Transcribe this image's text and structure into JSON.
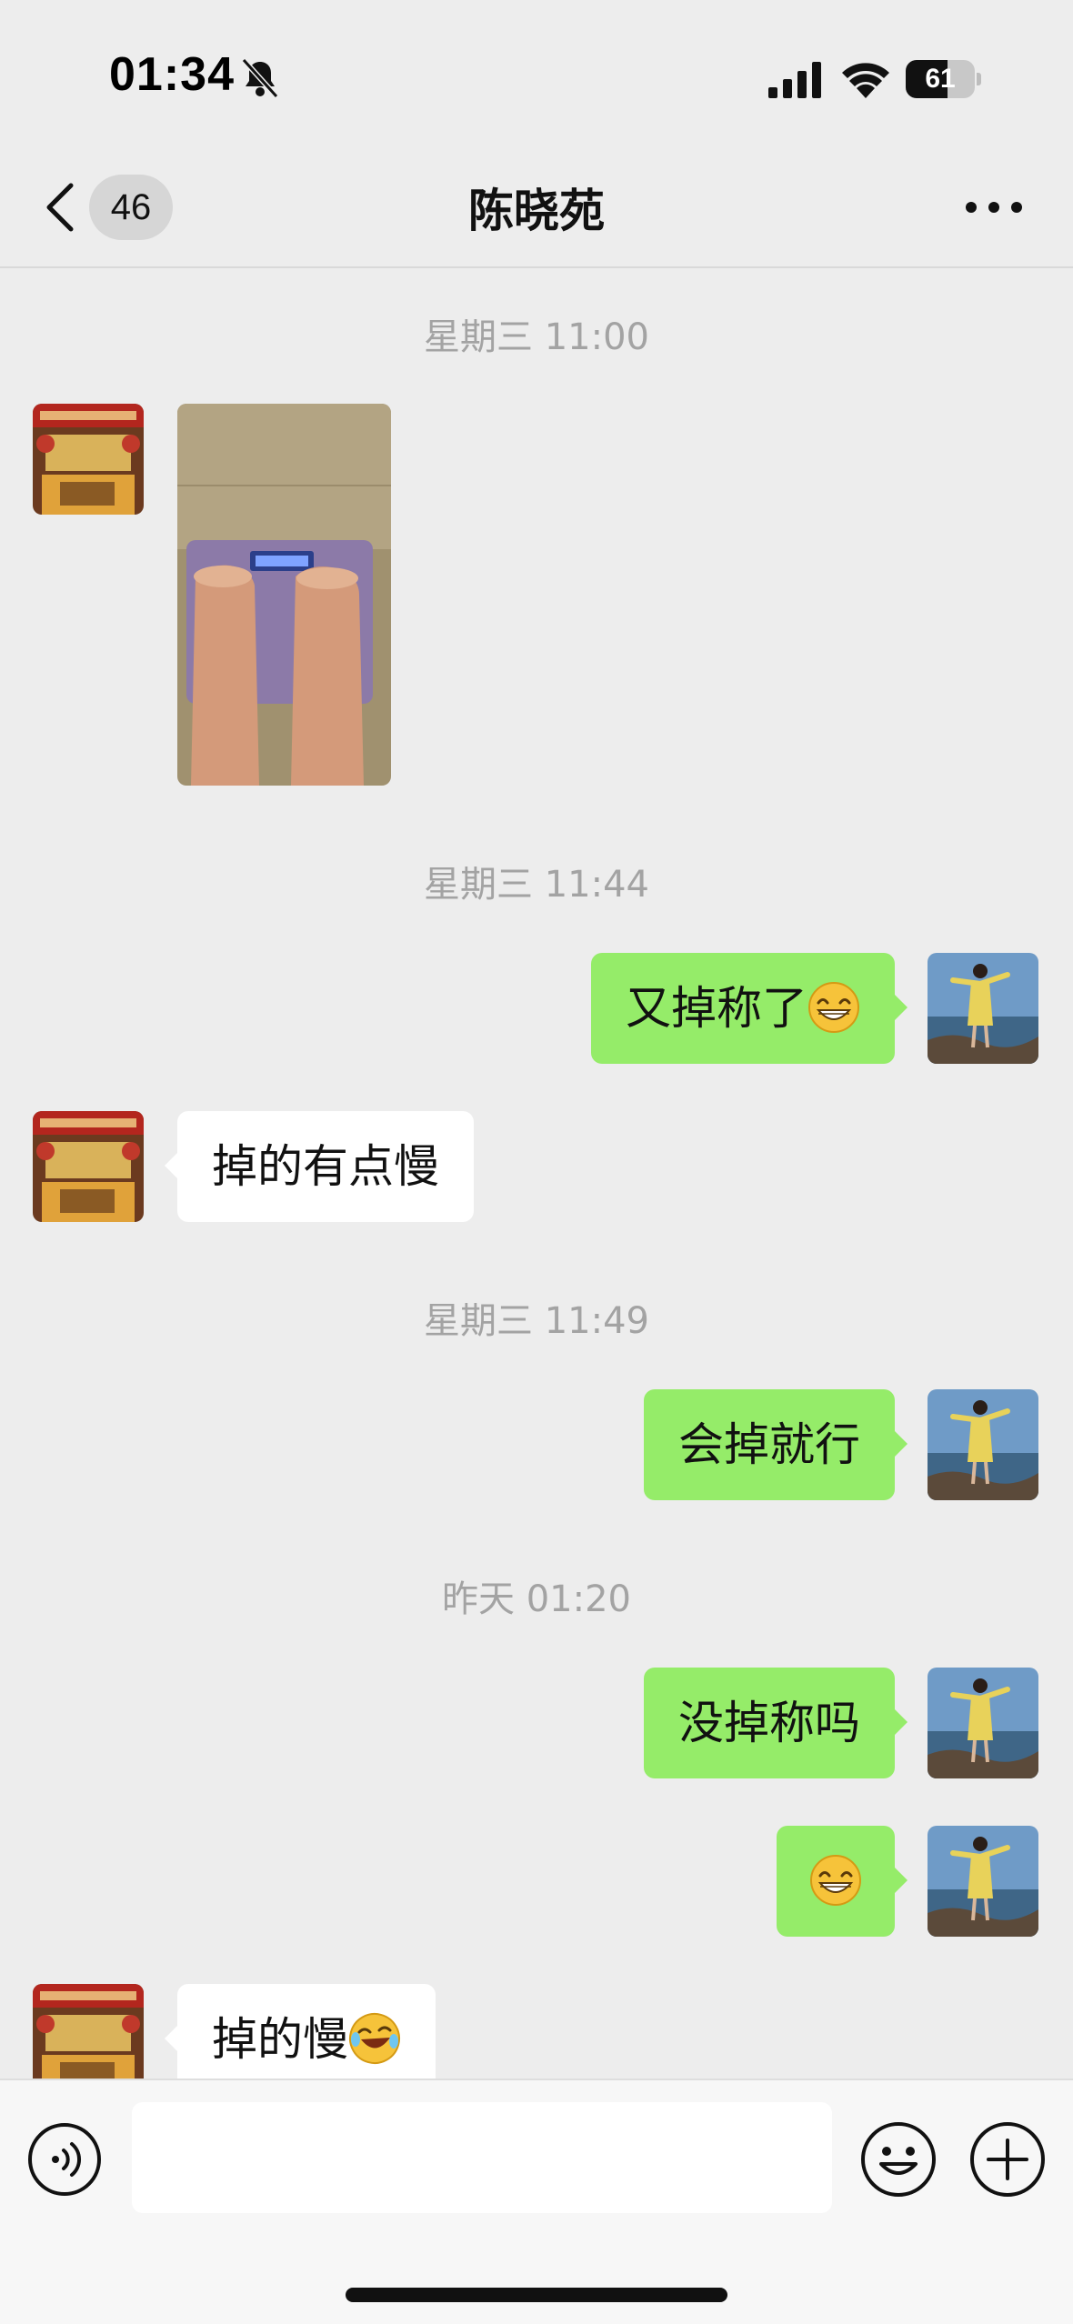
{
  "status_bar": {
    "time": "01:34",
    "battery_level": "61",
    "battery_fraction": 0.61,
    "icons": [
      "bell-slash-icon",
      "cellular-signal-icon",
      "wifi-icon",
      "battery-icon"
    ]
  },
  "nav": {
    "unread_count": "46",
    "title": "陈晓苑",
    "icons": [
      "chevron-left-icon",
      "more-icon"
    ]
  },
  "messages": [
    {
      "type": "timestamp",
      "text": "星期三 11:00"
    },
    {
      "type": "image",
      "side": "left",
      "description_icon": "scale-photo"
    },
    {
      "type": "timestamp",
      "text": "星期三 11:44"
    },
    {
      "type": "text",
      "side": "right",
      "text": "又掉称了",
      "emoji": "grinning-face"
    },
    {
      "type": "text",
      "side": "left",
      "text": "掉的有点慢"
    },
    {
      "type": "timestamp",
      "text": "星期三 11:49"
    },
    {
      "type": "text",
      "side": "right",
      "text": "会掉就行"
    },
    {
      "type": "timestamp",
      "text": "昨天 01:20"
    },
    {
      "type": "text",
      "side": "right",
      "text": "没掉称吗"
    },
    {
      "type": "emoji",
      "side": "right",
      "emoji": "grinning-face"
    },
    {
      "type": "text",
      "side": "left",
      "text": "掉的慢",
      "emoji": "rolling-laughing-face"
    }
  ],
  "input_bar": {
    "placeholder": "",
    "icons": [
      "voice-icon",
      "emoji-icon",
      "plus-icon"
    ]
  },
  "colors": {
    "background": "#ededed",
    "outgoing_bubble": "#95ec69",
    "incoming_bubble": "#ffffff",
    "timestamp_text": "#a3a3a3"
  }
}
